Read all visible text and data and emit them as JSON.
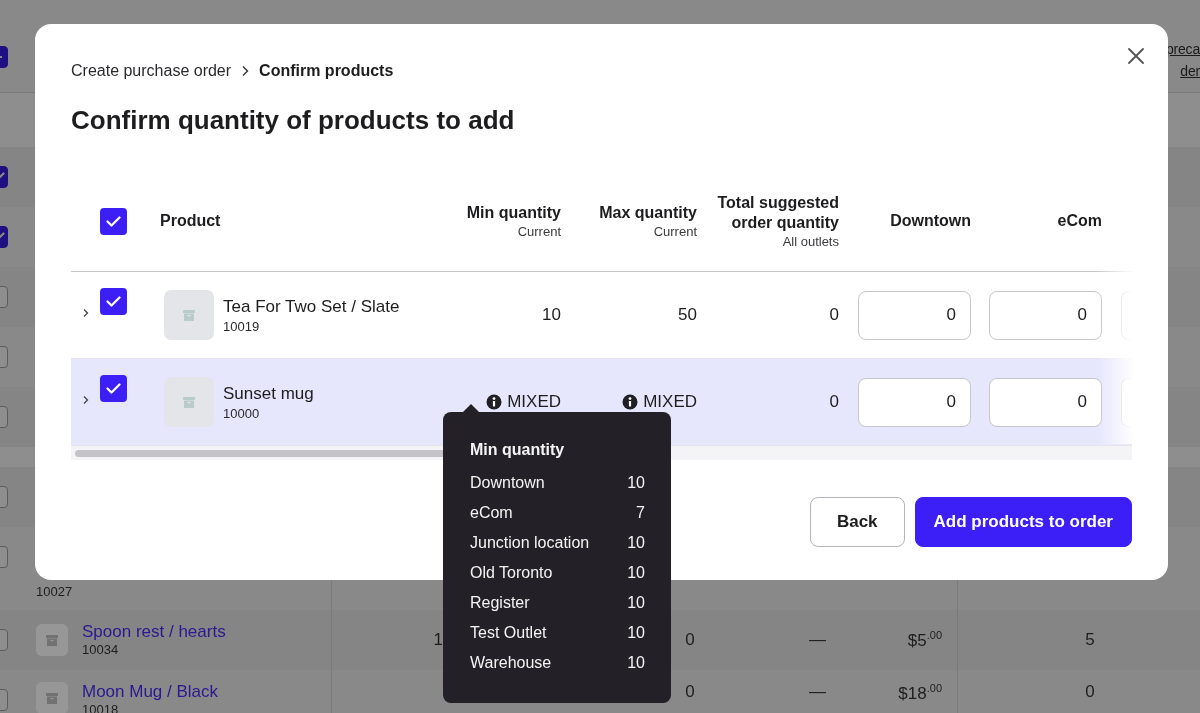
{
  "background_table": {
    "select_all": {
      "indeterminate": true
    },
    "header_text": [
      "preca",
      "der"
    ],
    "rows": [
      {
        "kind": "spacer"
      },
      {
        "kind": "product",
        "checked": true
      },
      {
        "kind": "product",
        "checked": true
      },
      {
        "kind": "product",
        "checked": false
      },
      {
        "kind": "product",
        "checked": false
      },
      {
        "kind": "product",
        "checked": false
      },
      {
        "kind": "spacer"
      },
      {
        "kind": "product",
        "checked": false
      },
      {
        "kind": "product",
        "checked": false,
        "sku": "10027"
      },
      {
        "kind": "product",
        "checked": false,
        "name": "Spoon rest / hearts",
        "sku": "10034",
        "cells": [
          "1",
          null,
          "0",
          "—",
          "$5$^{.00}$",
          "5"
        ]
      },
      {
        "kind": "product",
        "checked": false,
        "name": "Moon Mug / Black",
        "sku": "10018",
        "cells": [
          null,
          null,
          "0",
          "—",
          "$18$^{.00}$",
          "0"
        ]
      }
    ]
  },
  "modal": {
    "breadcrumbs": [
      {
        "label": "Create purchase order",
        "current": false
      },
      {
        "label": "Confirm products",
        "current": true
      }
    ],
    "title": "Confirm quantity of products to add",
    "table": {
      "select_all": {
        "checked": true
      },
      "columns": [
        {
          "label": "Product"
        },
        {
          "label": "Min quantity",
          "sublabel": "Current"
        },
        {
          "label": "Max quantity",
          "sublabel": "Current"
        },
        {
          "label": "Total suggested order quantity",
          "sublabel": "All outlets"
        },
        {
          "label": "Downtown"
        },
        {
          "label": "eCom"
        }
      ],
      "rows": [
        {
          "expanded": false,
          "checked": true,
          "highlighted": false,
          "name": "Tea For Two Set / Slate",
          "sku": "10019",
          "min": {
            "text": "10",
            "info": false
          },
          "max": {
            "text": "50",
            "info": false
          },
          "total": "0",
          "quantities": [
            {
              "value": "0",
              "partial": false
            },
            {
              "value": "0",
              "partial": false
            },
            {
              "partial": true
            }
          ]
        },
        {
          "expanded": false,
          "checked": true,
          "highlighted": true,
          "name": "Sunset mug",
          "sku": "10000",
          "min": {
            "text": "MIXED",
            "info": true
          },
          "max": {
            "text": "MIXED",
            "info": true
          },
          "total": "0",
          "quantities": [
            {
              "value": "0",
              "partial": false
            },
            {
              "value": "0",
              "partial": false
            },
            {
              "partial": true
            }
          ]
        }
      ]
    },
    "buttons": [
      {
        "label": "Back",
        "primary": false
      },
      {
        "label": "Add products to order",
        "primary": true
      }
    ]
  },
  "tooltip": {
    "title": "Min quantity",
    "rows": [
      {
        "label": "Downtown",
        "value": "10"
      },
      {
        "label": "eCom",
        "value": "7"
      },
      {
        "label": "Junction location",
        "value": "10"
      },
      {
        "label": "Old Toronto",
        "value": "10"
      },
      {
        "label": "Register",
        "value": "10"
      },
      {
        "label": "Test Outlet",
        "value": "10"
      },
      {
        "label": "Warehouse",
        "value": "10"
      }
    ]
  }
}
